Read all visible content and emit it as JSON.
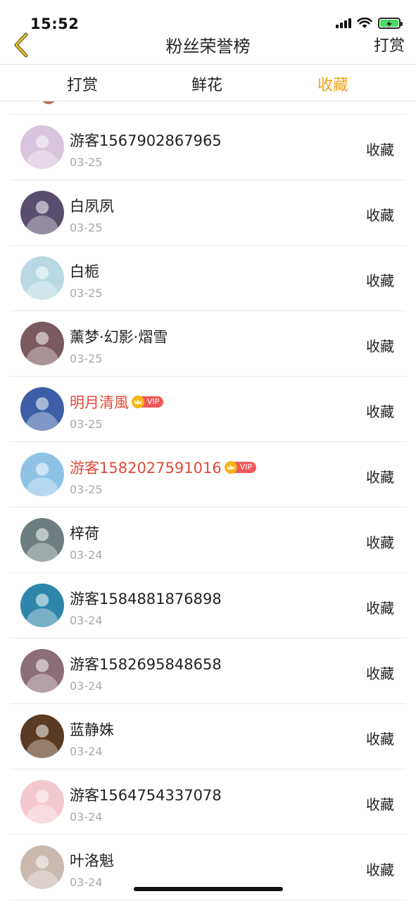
{
  "status": {
    "time": "15:52"
  },
  "nav": {
    "title": "粉丝荣誉榜",
    "action": "打赏"
  },
  "tabs": [
    {
      "label": "打赏"
    },
    {
      "label": "鲜花"
    },
    {
      "label": "收藏",
      "active": true
    }
  ],
  "colors": {
    "accent": "#f0a318",
    "vip_name": "#e14a3a",
    "vip_tag": "#f0575a",
    "date": "#a8a8a8"
  },
  "rows": [
    {
      "name": "游客1567902867965",
      "date": "03-25",
      "action": "收藏",
      "vip": false,
      "vip_label": "",
      "avatar_color": "#d8c4dc"
    },
    {
      "name": "白夙夙",
      "date": "03-25",
      "action": "收藏",
      "vip": false,
      "vip_label": "",
      "avatar_color": "#5a4e6e"
    },
    {
      "name": "白栀",
      "date": "03-25",
      "action": "收藏",
      "vip": false,
      "vip_label": "",
      "avatar_color": "#b9d9e2"
    },
    {
      "name": "薰梦·幻影·熠雪",
      "date": "03-25",
      "action": "收藏",
      "vip": false,
      "vip_label": "",
      "avatar_color": "#7a5a5e"
    },
    {
      "name": "明月清風",
      "date": "03-25",
      "action": "收藏",
      "vip": true,
      "vip_label": "VIP",
      "avatar_color": "#3c5fa8"
    },
    {
      "name": "游客1582027591016",
      "date": "03-25",
      "action": "收藏",
      "vip": true,
      "vip_label": "VIP",
      "avatar_color": "#8ec3e6"
    },
    {
      "name": "梓荷",
      "date": "03-24",
      "action": "收藏",
      "vip": false,
      "vip_label": "",
      "avatar_color": "#6e7e80"
    },
    {
      "name": "游客1584881876898",
      "date": "03-24",
      "action": "收藏",
      "vip": false,
      "vip_label": "",
      "avatar_color": "#2f86ab"
    },
    {
      "name": "游客1582695848658",
      "date": "03-24",
      "action": "收藏",
      "vip": false,
      "vip_label": "",
      "avatar_color": "#8a6f78"
    },
    {
      "name": "蓝静姝",
      "date": "03-24",
      "action": "收藏",
      "vip": false,
      "vip_label": "",
      "avatar_color": "#5a3a22"
    },
    {
      "name": "游客1564754337078",
      "date": "03-24",
      "action": "收藏",
      "vip": false,
      "vip_label": "",
      "avatar_color": "#f3c9cf"
    },
    {
      "name": "叶洛魁",
      "date": "03-24",
      "action": "收藏",
      "vip": false,
      "vip_label": "",
      "avatar_color": "#c9b9ae"
    }
  ]
}
